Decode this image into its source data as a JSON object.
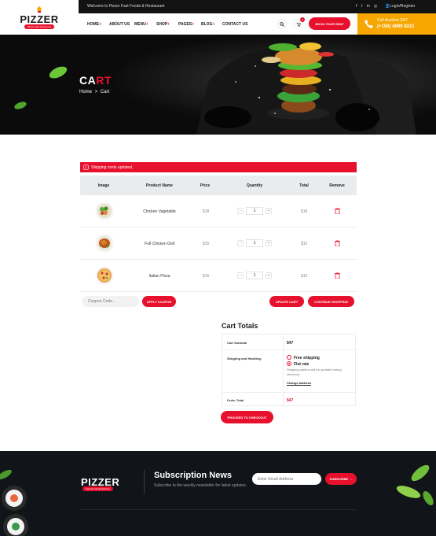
{
  "brand": {
    "logo_text": "PIZZER",
    "logo_tagline": "Fast Foods Restaurant",
    "accent": "#e8112d",
    "call_color": "#f7a600"
  },
  "topbar": {
    "welcome": "Welcome to Pizzer Fast Foods & Restaurant",
    "socials": [
      "facebook-icon",
      "twitter-icon",
      "linkedin-icon",
      "instagram-icon"
    ],
    "login": "Login/Register"
  },
  "nav": {
    "items": [
      {
        "label": "HOME",
        "has_sub": true
      },
      {
        "label": "ABOUT US",
        "has_sub": false
      },
      {
        "label": "MENU",
        "has_sub": true
      },
      {
        "label": "SHOP",
        "has_sub": true
      },
      {
        "label": "PAGES",
        "has_sub": true
      },
      {
        "label": "BLOG",
        "has_sub": true
      },
      {
        "label": "CONTACT US",
        "has_sub": false
      }
    ],
    "cart_count": "0",
    "book_label": "BOOK YOUR SEAT",
    "call_label": "Call Anytime 24/7",
    "call_number": "(+150) 4899 8221",
    "plus": "+"
  },
  "hero": {
    "title_a": "CA",
    "title_b": "RT",
    "breadcrumb_home": "Home",
    "breadcrumb_sep": ">",
    "breadcrumb_current": "Cart"
  },
  "notice": "Shipping costs updated.",
  "cart": {
    "headers": [
      "Image",
      "Product Name",
      "Price",
      "Quantity",
      "Total",
      "Remove"
    ],
    "rows": [
      {
        "name": "Chicken Vagetable",
        "price": "$18",
        "qty": "1",
        "total": "$18"
      },
      {
        "name": "Full Chicken Grill",
        "price": "$15",
        "qty": "1",
        "total": "$15"
      },
      {
        "name": "Italian Pizza",
        "price": "$15",
        "qty": "1",
        "total": "$15"
      }
    ],
    "minus": "−",
    "plus": "+",
    "coupon_placeholder": "Coupon Code...",
    "apply_label": "APPLY COUPON",
    "update_label": "UPDATE CART",
    "continue_label": "CONTINUE SHOPPING"
  },
  "totals": {
    "title": "Cart Totals",
    "subtotal_label": "Cart Subtotal",
    "subtotal_value": "$47",
    "shipping_label": "Shipping and Handling",
    "free_shipping": "Free shipping",
    "flat_rate": "Flat rate",
    "shipping_note": "Shipping options will be updated during checkout.",
    "change_address": "Change address",
    "order_total_label": "Order Total",
    "order_total_value": "$47",
    "checkout_label": "PROCEED TO CHECKOUT"
  },
  "footer": {
    "logo_text": "PIZZER",
    "logo_tagline": "Fast Foods Restaurant",
    "title": "Subscription News",
    "subtitle": "Subscribe to the weekly newsletter for latest updates.",
    "email_placeholder": "Enter Email Address",
    "subscribe_label": "SUBSCRIBE →"
  }
}
